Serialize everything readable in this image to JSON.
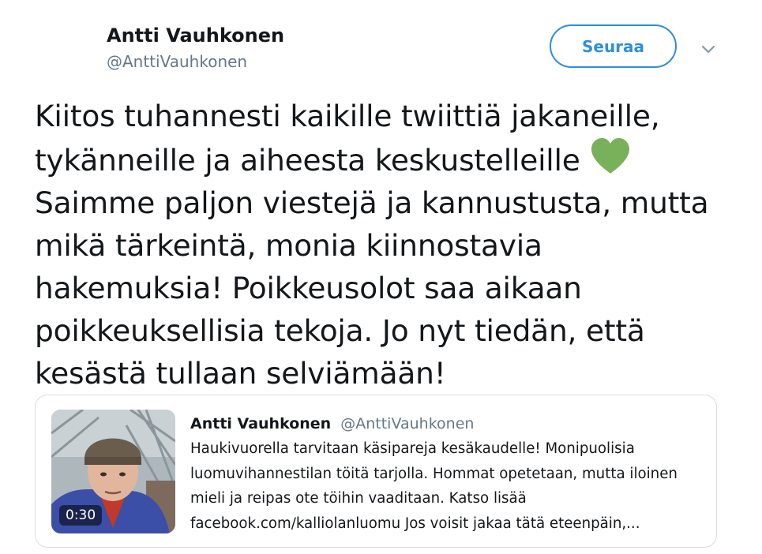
{
  "author": {
    "name": "Antti Vauhkonen",
    "handle": "@AnttiVauhkonen"
  },
  "follow_label": "Seuraa",
  "tweet": {
    "lines": [
      "Kiitos tuhannesti kaikille twiittiä jakaneille,",
      "tykänneille ja aiheesta keskustelleille",
      "Saimme paljon viestejä ja kannustusta, mutta",
      "mikä tärkeintä, monia kiinnostavia",
      "hakemuksia! Poikkeusolot saa aikaan",
      "poikkeuksellisia tekoja. Jo nyt tiedän, että",
      "kesästä tullaan selviämään!"
    ],
    "emoji": "green-heart-icon"
  },
  "quote": {
    "author_name": "Antti Vauhkonen",
    "author_handle": "@AnttiVauhkonen",
    "video_duration": "0:30",
    "lines": [
      "Haukivuorella tarvitaan käsipareja kesäkaudelle! Monipuolisia",
      "luomuvihannestilan töitä tarjolla. Hommat opetetaan, mutta iloinen",
      "mieli ja reipas ote töihin vaaditaan. Katso lisää",
      "facebook.com/kalliolanluomu Jos voisit jakaa tätä eteenpäin,..."
    ]
  },
  "colors": {
    "accent": "#2d8fdd",
    "heart": "#78b159",
    "text": "#14171a",
    "muted": "#657786"
  }
}
